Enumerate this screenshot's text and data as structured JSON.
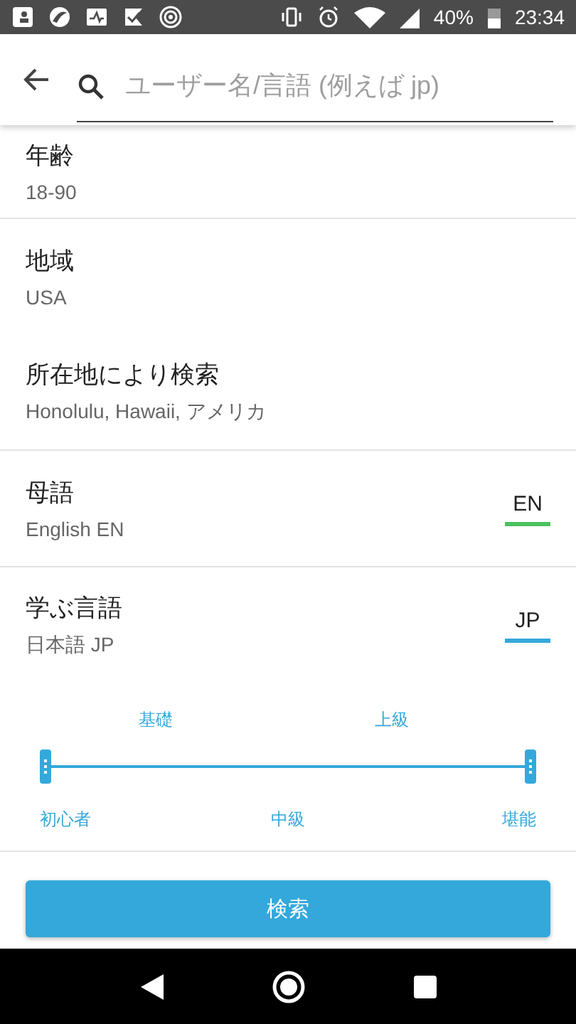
{
  "status_bar": {
    "battery_text": "40%",
    "time": "23:34"
  },
  "search": {
    "placeholder": "ユーザー名/言語 (例えば jp)"
  },
  "sections": [
    {
      "kind": "plain",
      "label": "年齢",
      "value": "18-90",
      "divider": true
    },
    {
      "kind": "plain",
      "label": "地域",
      "value": "USA",
      "divider": false
    },
    {
      "kind": "plain",
      "label": "所在地により検索",
      "value": "Honolulu, Hawaii, アメリカ",
      "divider": true
    },
    {
      "kind": "language",
      "label": "母語",
      "value": "English EN",
      "code": "EN",
      "color": "#4cc160",
      "divider": true
    },
    {
      "kind": "language",
      "label": "学ぶ言語",
      "value": "日本語 JP",
      "code": "JP",
      "color": "#34a8db",
      "divider": false
    }
  ],
  "level_slider": {
    "top_labels": [
      "基礎",
      "上級"
    ],
    "bottom_labels": [
      "初心者",
      "中級",
      "堪能"
    ]
  },
  "search_button": "検索"
}
